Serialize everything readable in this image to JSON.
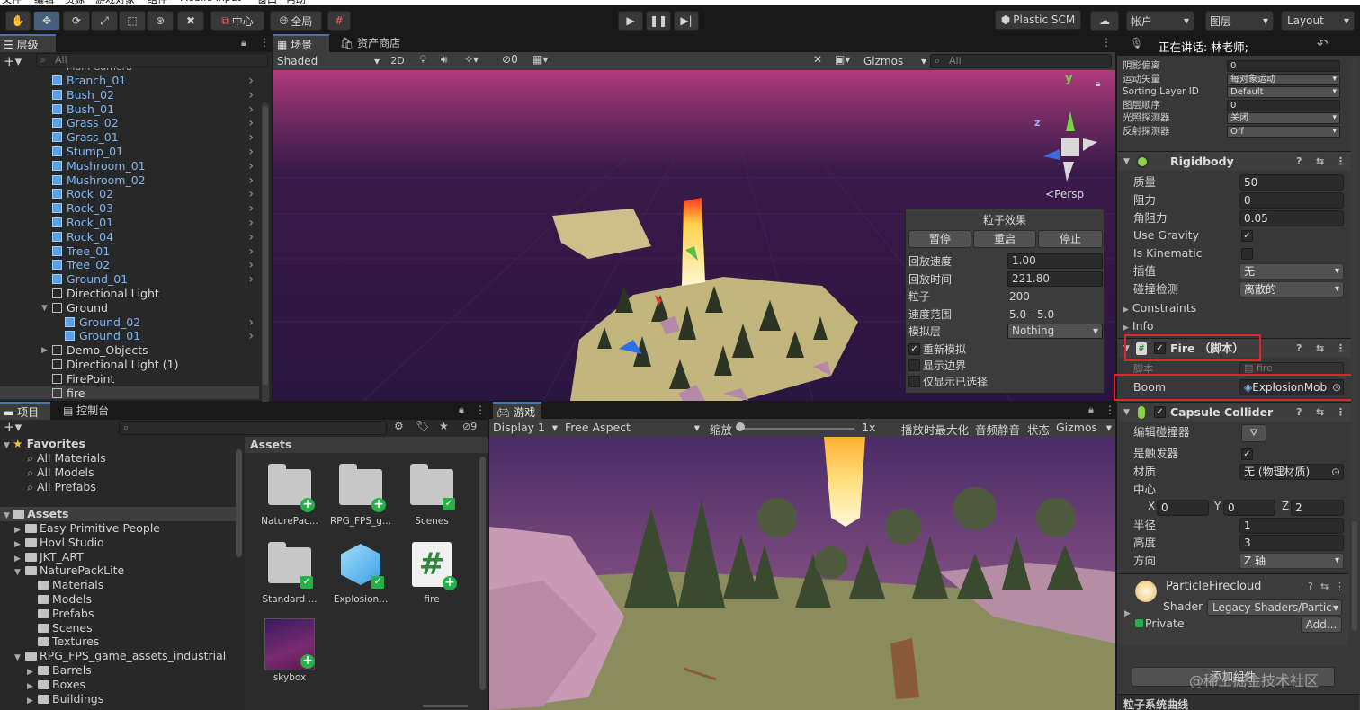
{
  "menu": [
    "文件",
    "编辑",
    "资源",
    "游戏对象",
    "组件",
    "Mobile Input",
    "窗口",
    "帮助"
  ],
  "toolbar": {
    "pivot": "中心",
    "space": "全局",
    "plastic": "Plastic SCM",
    "account": "帐户",
    "layers": "图层",
    "layout": "Layout"
  },
  "hierarchy": {
    "tab": "层级",
    "search_placeholder": "All",
    "items": [
      {
        "label": "Branch_01",
        "indent": 1,
        "prefab": true,
        "arrow": true
      },
      {
        "label": "Bush_02",
        "indent": 1,
        "prefab": true,
        "arrow": true
      },
      {
        "label": "Bush_01",
        "indent": 1,
        "prefab": true,
        "arrow": true
      },
      {
        "label": "Grass_02",
        "indent": 1,
        "prefab": true,
        "arrow": true
      },
      {
        "label": "Grass_01",
        "indent": 1,
        "prefab": true,
        "arrow": true
      },
      {
        "label": "Stump_01",
        "indent": 1,
        "prefab": true,
        "arrow": true
      },
      {
        "label": "Mushroom_01",
        "indent": 1,
        "prefab": true,
        "arrow": true
      },
      {
        "label": "Mushroom_02",
        "indent": 1,
        "prefab": true,
        "arrow": true
      },
      {
        "label": "Rock_02",
        "indent": 1,
        "prefab": true,
        "arrow": true
      },
      {
        "label": "Rock_03",
        "indent": 1,
        "prefab": true,
        "arrow": true
      },
      {
        "label": "Rock_01",
        "indent": 1,
        "prefab": true,
        "arrow": true
      },
      {
        "label": "Rock_04",
        "indent": 1,
        "prefab": true,
        "arrow": true
      },
      {
        "label": "Tree_01",
        "indent": 1,
        "prefab": true,
        "arrow": true
      },
      {
        "label": "Tree_02",
        "indent": 1,
        "prefab": true,
        "arrow": true
      },
      {
        "label": "Ground_01",
        "indent": 1,
        "prefab": true,
        "arrow": true
      },
      {
        "label": "Directional Light",
        "indent": 1,
        "prefab": false,
        "arrow": false
      },
      {
        "label": "Ground",
        "indent": 1,
        "prefab": false,
        "arrow": false,
        "expanded": true
      },
      {
        "label": "Ground_02",
        "indent": 2,
        "prefab": true,
        "arrow": true
      },
      {
        "label": "Ground_01",
        "indent": 2,
        "prefab": true,
        "arrow": true
      },
      {
        "label": "Demo_Objects",
        "indent": 1,
        "prefab": false,
        "arrow": false,
        "collapsed": true
      },
      {
        "label": "Directional Light (1)",
        "indent": 1,
        "prefab": false,
        "arrow": false
      },
      {
        "label": "FirePoint",
        "indent": 1,
        "prefab": false,
        "arrow": false
      },
      {
        "label": "fire",
        "indent": 1,
        "prefab": false,
        "arrow": false,
        "selected": true
      }
    ]
  },
  "scene": {
    "tabs": [
      "场景",
      "资产商店"
    ],
    "shading": "Shaded",
    "mode2d": "2D",
    "hidden_count": "0",
    "gizmos": "Gizmos",
    "search_placeholder": "All",
    "persp": "Persp",
    "axis_y": "y",
    "axis_z": "z"
  },
  "particle_panel": {
    "title": "粒子效果",
    "pause": "暂停",
    "restart": "重启",
    "stop": "停止",
    "rows": [
      {
        "label": "回放速度",
        "value": "1.00",
        "boxed": true
      },
      {
        "label": "回放时间",
        "value": "221.80",
        "boxed": true
      },
      {
        "label": "粒子",
        "value": "200",
        "boxed": false
      },
      {
        "label": "速度范围",
        "value": "5.0 - 5.0",
        "boxed": false
      }
    ],
    "layer_label": "模拟层",
    "layer_value": "Nothing",
    "checks": [
      {
        "label": "重新模拟",
        "checked": true
      },
      {
        "label": "显示边界",
        "checked": false
      },
      {
        "label": "仅显示已选择",
        "checked": false
      }
    ]
  },
  "project": {
    "tabs": [
      "项目",
      "控制台"
    ],
    "hidden_count": "9",
    "favorites_label": "Favorites",
    "favorites": [
      "All Materials",
      "All Models",
      "All Prefabs"
    ],
    "assets_label": "Assets",
    "tree": [
      {
        "label": "Easy Primitive People",
        "indent": 1,
        "arrow": "▶"
      },
      {
        "label": "Hovl Studio",
        "indent": 1,
        "arrow": "▶"
      },
      {
        "label": "JKT_ART",
        "indent": 1,
        "arrow": "▶"
      },
      {
        "label": "NaturePackLite",
        "indent": 1,
        "arrow": "▼"
      },
      {
        "label": "Materials",
        "indent": 2,
        "arrow": ""
      },
      {
        "label": "Models",
        "indent": 2,
        "arrow": ""
      },
      {
        "label": "Prefabs",
        "indent": 2,
        "arrow": ""
      },
      {
        "label": "Scenes",
        "indent": 2,
        "arrow": ""
      },
      {
        "label": "Textures",
        "indent": 2,
        "arrow": ""
      },
      {
        "label": "RPG_FPS_game_assets_industrial",
        "indent": 1,
        "arrow": "▼"
      },
      {
        "label": "Barrels",
        "indent": 2,
        "arrow": "▶"
      },
      {
        "label": "Boxes",
        "indent": 2,
        "arrow": "▶"
      },
      {
        "label": "Buildings",
        "indent": 2,
        "arrow": "▶"
      }
    ],
    "grid_header": "Assets",
    "assets": [
      {
        "label": "NaturePac...",
        "kind": "folder",
        "badge": "plus"
      },
      {
        "label": "RPG_FPS_g...",
        "kind": "folder",
        "badge": "plus"
      },
      {
        "label": "Scenes",
        "kind": "folder",
        "badge": "check"
      },
      {
        "label": "Standard ...",
        "kind": "folder",
        "badge": "check"
      },
      {
        "label": "Explosion...",
        "kind": "prefab",
        "badge": "check"
      },
      {
        "label": "fire",
        "kind": "script",
        "badge": "plus"
      },
      {
        "label": "skybox",
        "kind": "material",
        "badge": "plus"
      }
    ]
  },
  "game": {
    "tab": "游戏",
    "display": "Display 1",
    "aspect": "Free Aspect",
    "scale_label": "缩放",
    "scale_value": "1x",
    "maximize": "播放时最大化",
    "mute": "音频静音",
    "stats": "状态",
    "gizmos": "Gizmos"
  },
  "inspector": {
    "speaking": "正在讲话: 林老师;",
    "renderer_rows": [
      {
        "label": "阴影偏离",
        "value": "0",
        "drop": false
      },
      {
        "label": "运动矢量",
        "value": "每对象运动",
        "drop": true
      },
      {
        "label": "Sorting Layer ID",
        "value": "Default",
        "drop": true
      },
      {
        "label": "图层顺序",
        "value": "0",
        "drop": false
      },
      {
        "label": "光照探测器",
        "value": "关闭",
        "drop": true
      },
      {
        "label": "反射探测器",
        "value": "Off",
        "drop": true
      }
    ],
    "rigidbody": {
      "title": "Rigidbody",
      "mass_label": "质量",
      "mass": "50",
      "drag_label": "阻力",
      "drag": "0",
      "angular_label": "角阻力",
      "angular": "0.05",
      "gravity_label": "Use Gravity",
      "kinematic_label": "Is Kinematic",
      "interp_label": "插值",
      "interp": "无",
      "collision_label": "碰撞检测",
      "collision": "离散的",
      "constraints": "Constraints",
      "info": "Info"
    },
    "fire": {
      "title": "Fire （脚本）",
      "script_label": "脚本",
      "script": "fire",
      "boom_label": "Boom",
      "boom": "ExplosionMob"
    },
    "capsule": {
      "title": "Capsule Collider",
      "edit_label": "编辑碰撞器",
      "trigger_label": "是触发器",
      "material_label": "材质",
      "material": "无 (物理材质)",
      "center_label": "中心",
      "cx": "0",
      "cy": "0",
      "cz": "2",
      "x": "X",
      "y": "Y",
      "z": "Z",
      "radius_label": "半径",
      "radius": "1",
      "height_label": "高度",
      "height": "3",
      "dir_label": "方向",
      "dir": "Z 轴"
    },
    "material": {
      "name": "ParticleFirecloud",
      "shader_label": "Shader",
      "shader": "Legacy Shaders/Particl",
      "private": "Private",
      "add": "Add..."
    },
    "add_component": "添加组件",
    "watermark": "@稀土掘金技术社区",
    "bottom": "粒子系统曲线"
  },
  "colors": {
    "highlight_red": "#e0262b",
    "accent_blue": "#3a79bb",
    "prefab_blue": "#7eb6f1",
    "badge_green": "#27b04a"
  }
}
